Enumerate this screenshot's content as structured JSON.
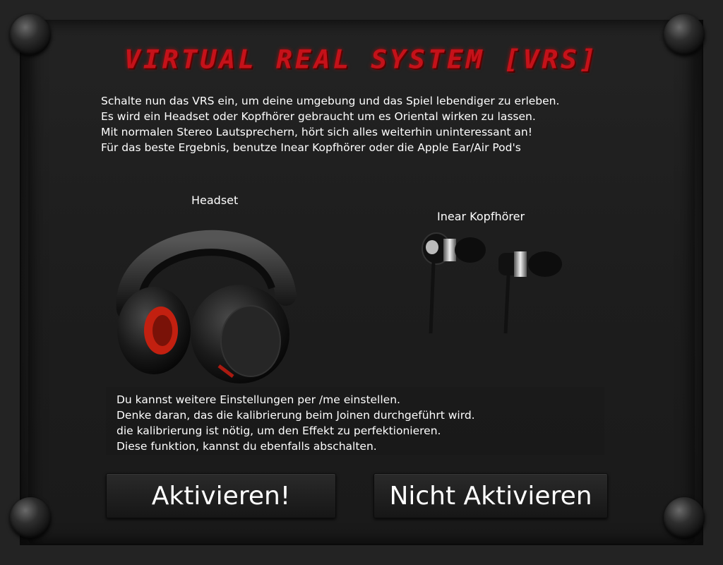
{
  "title": "VIRTUAL REAL SYSTEM [VRS]",
  "intro_lines": [
    "Schalte nun das VRS ein, um deine umgebung und das Spiel lebendiger  zu erleben.",
    "Es wird ein Headset oder Kopfhörer gebraucht um es Oriental wirken zu lassen.",
    "Mit normalen Stereo Lautsprechern,  hört sich alles weiterhin uninteressant an!",
    "Für das beste Ergebnis, benutze Inear Kopfhörer oder die Apple Ear/Air Pod's"
  ],
  "options": {
    "headset_label": "Headset",
    "inear_label": "Inear Kopfhörer"
  },
  "info_lines": [
    "Du kannst weitere Einstellungen per /me einstellen.",
    "Denke daran, das die kalibrierung beim Joinen durchgeführt wird.",
    "die kalibrierung ist nötig, um den Effekt zu perfektionieren.",
    "Diese funktion, kannst du ebenfalls abschalten."
  ],
  "buttons": {
    "activate": "Aktivieren!",
    "deactivate": "Nicht Aktivieren"
  },
  "colors": {
    "title_red": "#c4121a",
    "background": "#1e1e1e"
  },
  "icons": {
    "headset": "headset-icon",
    "inear": "inear-headphones-icon"
  }
}
